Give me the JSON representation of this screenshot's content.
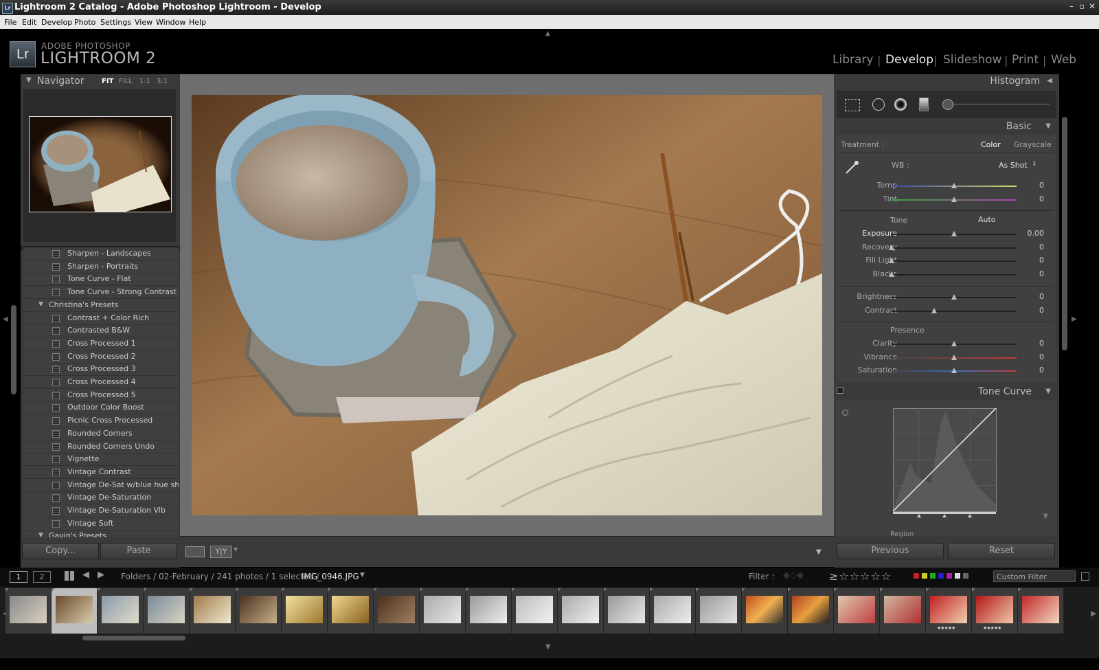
{
  "window": {
    "title": "Lightroom 2 Catalog - Adobe Photoshop Lightroom - Develop"
  },
  "menu": [
    "File",
    "Edit",
    "Develop",
    "Photo",
    "Settings",
    "View",
    "Window",
    "Help"
  ],
  "logo": {
    "badge": "Lr",
    "small": "ADOBE PHOTOSHOP",
    "large": "LIGHTROOM 2"
  },
  "modules": [
    "Library",
    "Develop",
    "Slideshow",
    "Print",
    "Web"
  ],
  "module_sep": "|",
  "navigator": {
    "title": "Navigator",
    "zoom": [
      "FIT",
      "FILL",
      "1:1",
      "3:1"
    ]
  },
  "presets": [
    {
      "label": "Sharpen - Landscapes",
      "group": false
    },
    {
      "label": "Sharpen - Portraits",
      "group": false
    },
    {
      "label": "Tone Curve - Flat",
      "group": false
    },
    {
      "label": "Tone Curve - Strong Contrast",
      "group": false
    },
    {
      "label": "Christina's Presets",
      "group": true
    },
    {
      "label": "Contrast + Color Rich",
      "group": false
    },
    {
      "label": "Contrasted B&W",
      "group": false
    },
    {
      "label": "Cross Processed 1",
      "group": false
    },
    {
      "label": "Cross Processed 2",
      "group": false
    },
    {
      "label": "Cross Processed 3",
      "group": false
    },
    {
      "label": "Cross Processed 4",
      "group": false
    },
    {
      "label": "Cross Processed 5",
      "group": false
    },
    {
      "label": "Outdoor Color Boost",
      "group": false
    },
    {
      "label": "Picnic Cross Processed",
      "group": false
    },
    {
      "label": "Rounded Corners",
      "group": false
    },
    {
      "label": "Rounded Corners Undo",
      "group": false
    },
    {
      "label": "Vignette",
      "group": false
    },
    {
      "label": "Vintage Contrast",
      "group": false
    },
    {
      "label": "Vintage De-Sat w/blue hue shift",
      "group": false
    },
    {
      "label": "Vintage De-Saturation",
      "group": false
    },
    {
      "label": "Vintage De-Saturation Vib",
      "group": false
    },
    {
      "label": "Vintage Soft",
      "group": false
    },
    {
      "label": "Gavin's Presets",
      "group": true
    }
  ],
  "left_buttons": {
    "copy": "Copy...",
    "paste": "Paste"
  },
  "toolbar": {
    "compare": "Y|Y"
  },
  "right": {
    "histogram": "Histogram",
    "basic": "Basic",
    "treatment_label": "Treatment :",
    "treatment_color": "Color",
    "treatment_gray": "Grayscale",
    "wb_label": "WB :",
    "wb_value": "As Shot",
    "tone_label": "Tone",
    "auto": "Auto",
    "presence_label": "Presence",
    "tone_curve": "Tone Curve",
    "region": "Region",
    "previous": "Previous",
    "reset": "Reset"
  },
  "sliders": [
    {
      "name": "Temp",
      "value": "0",
      "pos": 0.5
    },
    {
      "name": "Tint",
      "value": "0",
      "pos": 0.5
    },
    {
      "name": "Exposure",
      "value": "0.00",
      "pos": 0.5
    },
    {
      "name": "Recovery",
      "value": "0",
      "pos": 0.0
    },
    {
      "name": "Fill Light",
      "value": "0",
      "pos": 0.0
    },
    {
      "name": "Blacks",
      "value": "0",
      "pos": 0.0
    },
    {
      "name": "Brightness",
      "value": "0",
      "pos": 0.5
    },
    {
      "name": "Contrast",
      "value": "0",
      "pos": 0.34
    },
    {
      "name": "Clarity",
      "value": "0",
      "pos": 0.5
    },
    {
      "name": "Vibrance",
      "value": "0",
      "pos": 0.5
    },
    {
      "name": "Saturation",
      "value": "0",
      "pos": 0.5
    }
  ],
  "filmstrip": {
    "page1": "1",
    "page2": "2",
    "breadcrumb": "Folders / 02-February / 241 photos / 1 selected /",
    "filename": "IMG_0946.JPG",
    "filter_label": "Filter :",
    "filter_preset": "Custom Filter",
    "stars_rating": "★★★★★",
    "thumbnail_count": 23,
    "selected_index": 1,
    "starred_indices": [
      20,
      21
    ]
  },
  "colors": {
    "accent": "#e8e8e8",
    "panel": "#3a3a3a",
    "background": "#000000"
  }
}
